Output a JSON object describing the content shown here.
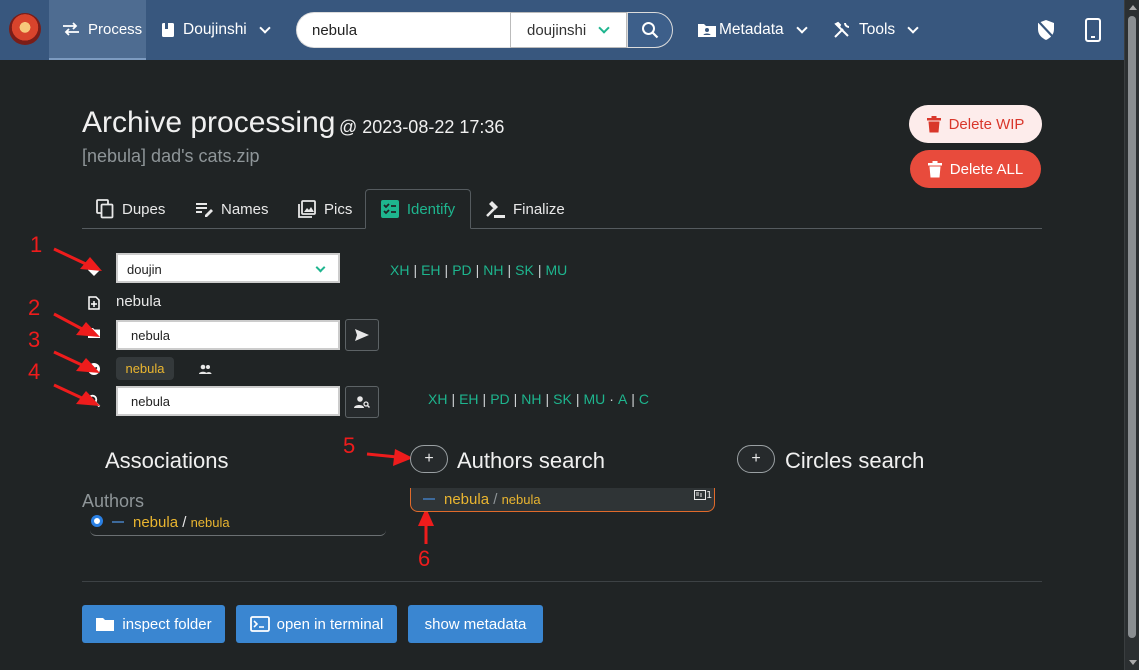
{
  "nav": {
    "process_label": "Process",
    "doujinshi_label": "Doujinshi",
    "search_value": "nebula",
    "search_category": "doujinshi",
    "metadata_label": "Metadata",
    "tools_label": "Tools"
  },
  "header": {
    "title": "Archive processing",
    "date": "@ 2023-08-22 17:36",
    "subtitle": "[nebula] dad's cats.zip",
    "delete_wip_label": "Delete WIP",
    "delete_all_label": "Delete ALL"
  },
  "tabs": [
    {
      "label": "Dupes"
    },
    {
      "label": "Names"
    },
    {
      "label": "Pics"
    },
    {
      "label": "Identify"
    },
    {
      "label": "Finalize"
    }
  ],
  "form": {
    "category_value": "doujin",
    "filename": "nebula",
    "folder_value": "nebula",
    "tag_chip": "nebula",
    "search_value": "nebula",
    "links_row1": [
      "XH",
      "EH",
      "PD",
      "NH",
      "SK",
      "MU"
    ],
    "links_row2": [
      "XH",
      "EH",
      "PD",
      "NH",
      "SK",
      "MU",
      "A",
      "C"
    ]
  },
  "annotations": [
    "1",
    "2",
    "3",
    "4",
    "5",
    "6"
  ],
  "associations": {
    "title": "Associations",
    "authors_label": "Authors",
    "entry_name": "nebula",
    "entry_slash": "/",
    "entry_alt": "nebula"
  },
  "authors_search": {
    "title": "Authors search",
    "add_label": "+",
    "result_name": "nebula",
    "result_slash": "/",
    "result_alt": "nebula",
    "result_count": "1"
  },
  "circles_search": {
    "title": "Circles search",
    "add_label": "+"
  },
  "actions": {
    "inspect_label": "inspect folder",
    "terminal_label": "open in terminal",
    "metadata_label": "show metadata"
  },
  "colors": {
    "nav_bg": "#38577e",
    "accent_teal": "#1eb58e",
    "tag_yellow": "#e9b530",
    "danger_red": "#e84b3c",
    "button_blue": "#3a86d1",
    "annotation_red": "#ee1c1c"
  }
}
